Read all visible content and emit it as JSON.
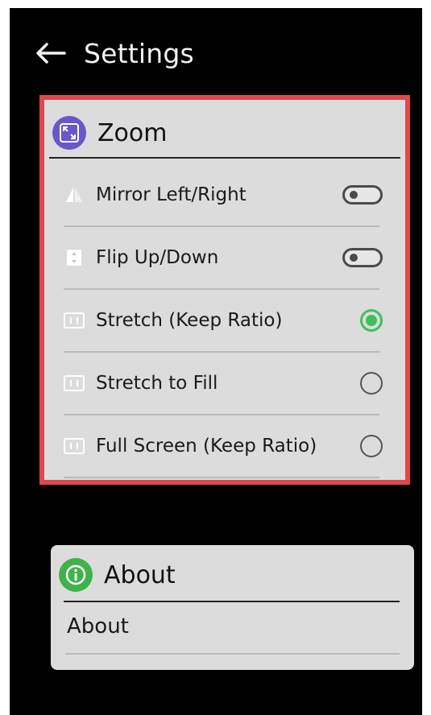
{
  "header": {
    "title": "Settings",
    "back_icon": "arrow-left-icon"
  },
  "zoom": {
    "title": "Zoom",
    "icon": "expand-icon",
    "icon_color": "#6a56c8",
    "highlight_color": "#e0474d",
    "items": [
      {
        "label": "Mirror Left/Right",
        "icon": "mirror-icon",
        "control": "toggle",
        "state": "off"
      },
      {
        "label": "Flip Up/Down",
        "icon": "flip-icon",
        "control": "toggle",
        "state": "off"
      },
      {
        "label": "Stretch (Keep Ratio)",
        "icon": "aspect-icon",
        "control": "radio",
        "state": "selected"
      },
      {
        "label": "Stretch to Fill",
        "icon": "aspect-icon",
        "control": "radio",
        "state": "unselected"
      },
      {
        "label": "Full Screen (Keep Ratio)",
        "icon": "aspect-icon",
        "control": "radio",
        "state": "unselected"
      }
    ]
  },
  "about": {
    "title": "About",
    "icon": "info-icon",
    "icon_color": "#3fb24a",
    "items": [
      {
        "label": "About"
      }
    ]
  },
  "accent": {
    "radio_selected": "#3fbf5c"
  }
}
